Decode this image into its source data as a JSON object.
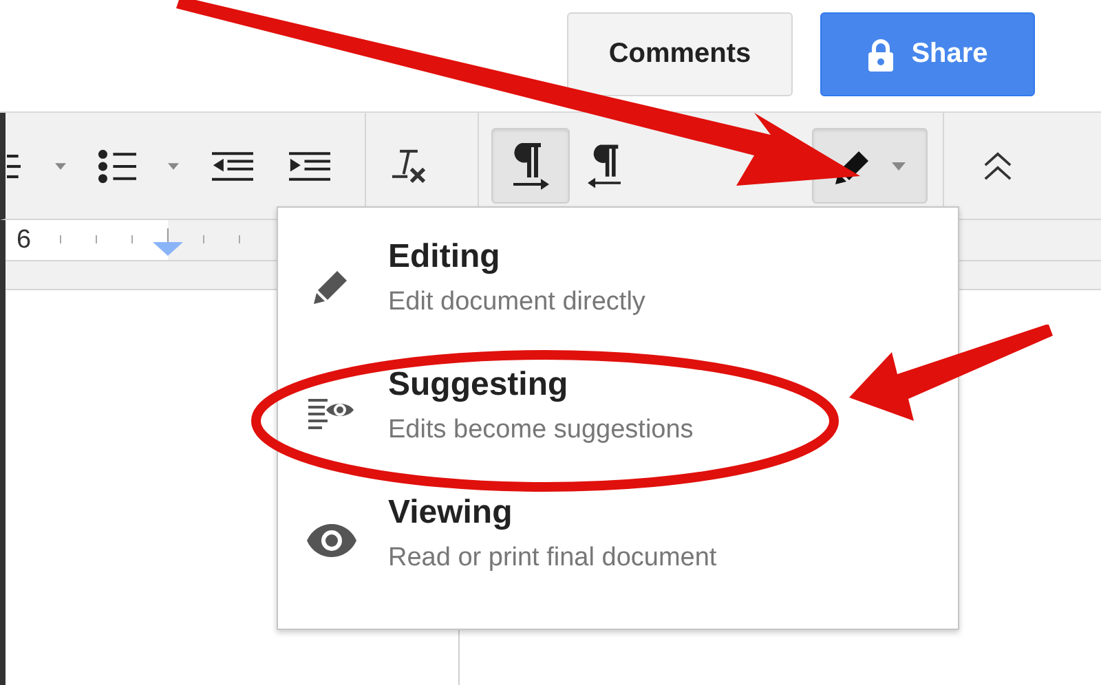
{
  "header": {
    "buttons": [
      {
        "kind": "comments",
        "label": "Comments"
      },
      {
        "kind": "share",
        "label": "Share"
      }
    ]
  },
  "toolbar": [
    {
      "kind": "align"
    },
    {
      "kind": "caret"
    },
    {
      "kind": "bulleted-list"
    },
    {
      "kind": "caret"
    },
    {
      "kind": "outdent"
    },
    {
      "kind": "indent"
    },
    {
      "kind": "separator"
    },
    {
      "kind": "clear-formatting"
    },
    {
      "kind": "separator"
    },
    {
      "kind": "ltr",
      "selected": true
    },
    {
      "kind": "rtl",
      "selected": false
    },
    {
      "kind": "mode",
      "expanded": true
    },
    {
      "kind": "separator"
    },
    {
      "kind": "collapse"
    }
  ],
  "ruler": {
    "label": "6"
  },
  "mode_menu": [
    {
      "kind": "editing",
      "title": "Editing",
      "description": "Edit document directly"
    },
    {
      "kind": "suggesting",
      "title": "Suggesting",
      "description": "Edits become suggestions"
    },
    {
      "kind": "viewing",
      "title": "Viewing",
      "description": "Read or print final document"
    }
  ],
  "annotations": [
    {
      "kind": "arrow"
    },
    {
      "kind": "arrow"
    },
    {
      "kind": "ellipse"
    }
  ]
}
